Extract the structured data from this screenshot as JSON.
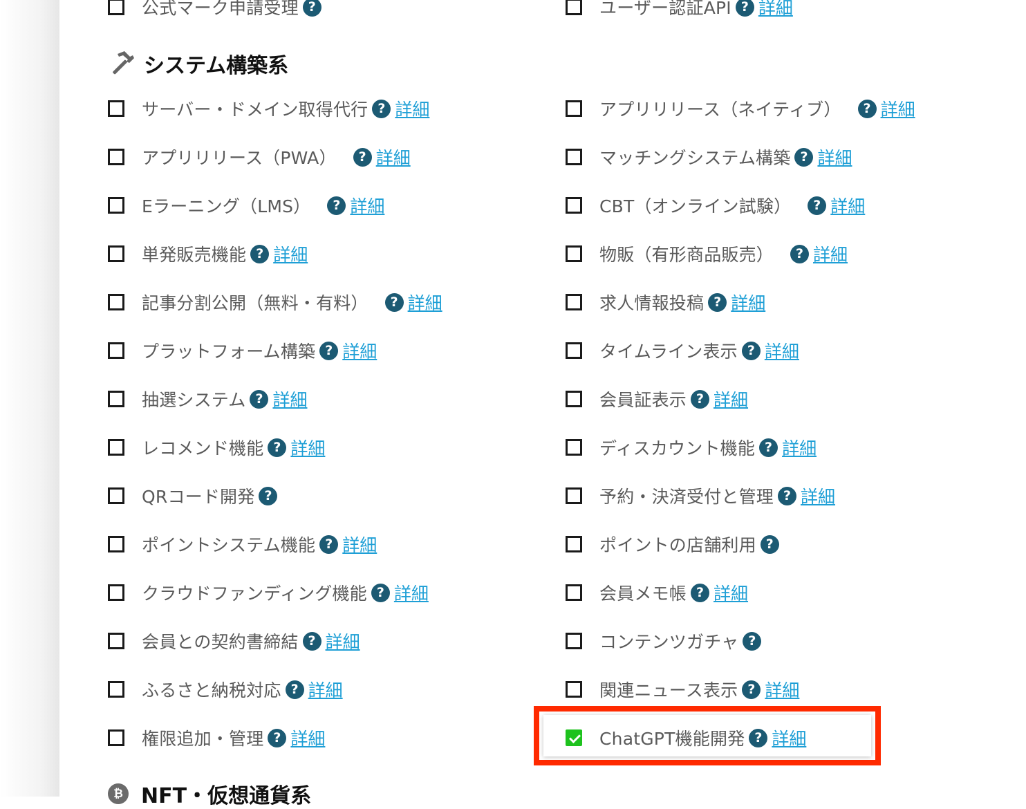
{
  "top_partial": {
    "left": {
      "label": "公式マーク申請受理",
      "help": "?"
    },
    "right": {
      "label": "ユーザー認証API",
      "help": "?",
      "detail": "詳細"
    }
  },
  "section": {
    "icon": "hammer-icon",
    "title": "システム構築系"
  },
  "left_items": [
    {
      "label": "サーバー・ドメイン取得代行",
      "help": "?",
      "detail": "詳細",
      "checked": false
    },
    {
      "label": "アプリリリース（PWA）",
      "help": "?",
      "detail": "詳細",
      "checked": false
    },
    {
      "label": "Eラーニング（LMS）",
      "help": "?",
      "detail": "詳細",
      "checked": false
    },
    {
      "label": "単発販売機能",
      "help": "?",
      "detail": "詳細",
      "checked": false
    },
    {
      "label": "記事分割公開（無料・有料）",
      "help": "?",
      "detail": "詳細",
      "checked": false
    },
    {
      "label": "プラットフォーム構築",
      "help": "?",
      "detail": "詳細",
      "checked": false
    },
    {
      "label": "抽選システム",
      "help": "?",
      "detail": "詳細",
      "checked": false
    },
    {
      "label": "レコメンド機能",
      "help": "?",
      "detail": "詳細",
      "checked": false
    },
    {
      "label": "QRコード開発",
      "help": "?",
      "detail": "",
      "checked": false
    },
    {
      "label": "ポイントシステム機能",
      "help": "?",
      "detail": "詳細",
      "checked": false
    },
    {
      "label": "クラウドファンディング機能",
      "help": "?",
      "detail": "詳細",
      "checked": false
    },
    {
      "label": "会員との契約書締結",
      "help": "?",
      "detail": "詳細",
      "checked": false
    },
    {
      "label": "ふるさと納税対応",
      "help": "?",
      "detail": "詳細",
      "checked": false
    },
    {
      "label": "権限追加・管理",
      "help": "?",
      "detail": "詳細",
      "checked": false
    }
  ],
  "right_items": [
    {
      "label": "アプリリリース（ネイティブ）",
      "help": "?",
      "detail": "詳細",
      "checked": false
    },
    {
      "label": "マッチングシステム構築",
      "help": "?",
      "detail": "詳細",
      "checked": false
    },
    {
      "label": "CBT（オンライン試験）",
      "help": "?",
      "detail": "詳細",
      "checked": false
    },
    {
      "label": "物販（有形商品販売）",
      "help": "?",
      "detail": "詳細",
      "checked": false
    },
    {
      "label": "求人情報投稿",
      "help": "?",
      "detail": "詳細",
      "checked": false
    },
    {
      "label": "タイムライン表示",
      "help": "?",
      "detail": "詳細",
      "checked": false
    },
    {
      "label": "会員証表示",
      "help": "?",
      "detail": "詳細",
      "checked": false
    },
    {
      "label": "ディスカウント機能",
      "help": "?",
      "detail": "詳細",
      "checked": false
    },
    {
      "label": "予約・決済受付と管理",
      "help": "?",
      "detail": "詳細",
      "checked": false
    },
    {
      "label": "ポイントの店舗利用",
      "help": "?",
      "detail": "",
      "checked": false
    },
    {
      "label": "会員メモ帳",
      "help": "?",
      "detail": "詳細",
      "checked": false
    },
    {
      "label": "コンテンツガチャ",
      "help": "?",
      "detail": "",
      "checked": false
    },
    {
      "label": "関連ニュース表示",
      "help": "?",
      "detail": "詳細",
      "checked": false
    },
    {
      "label": "ChatGPT機能開発",
      "help": "?",
      "detail": "詳細",
      "checked": true
    }
  ],
  "next_section": {
    "icon": "bitcoin-icon",
    "title": "NFT・仮想通貨系"
  },
  "colors": {
    "checked": "#1ec21e",
    "help_badge": "#1c5a73",
    "link": "#1e9fd6",
    "highlight_border": "#ff2a00"
  }
}
